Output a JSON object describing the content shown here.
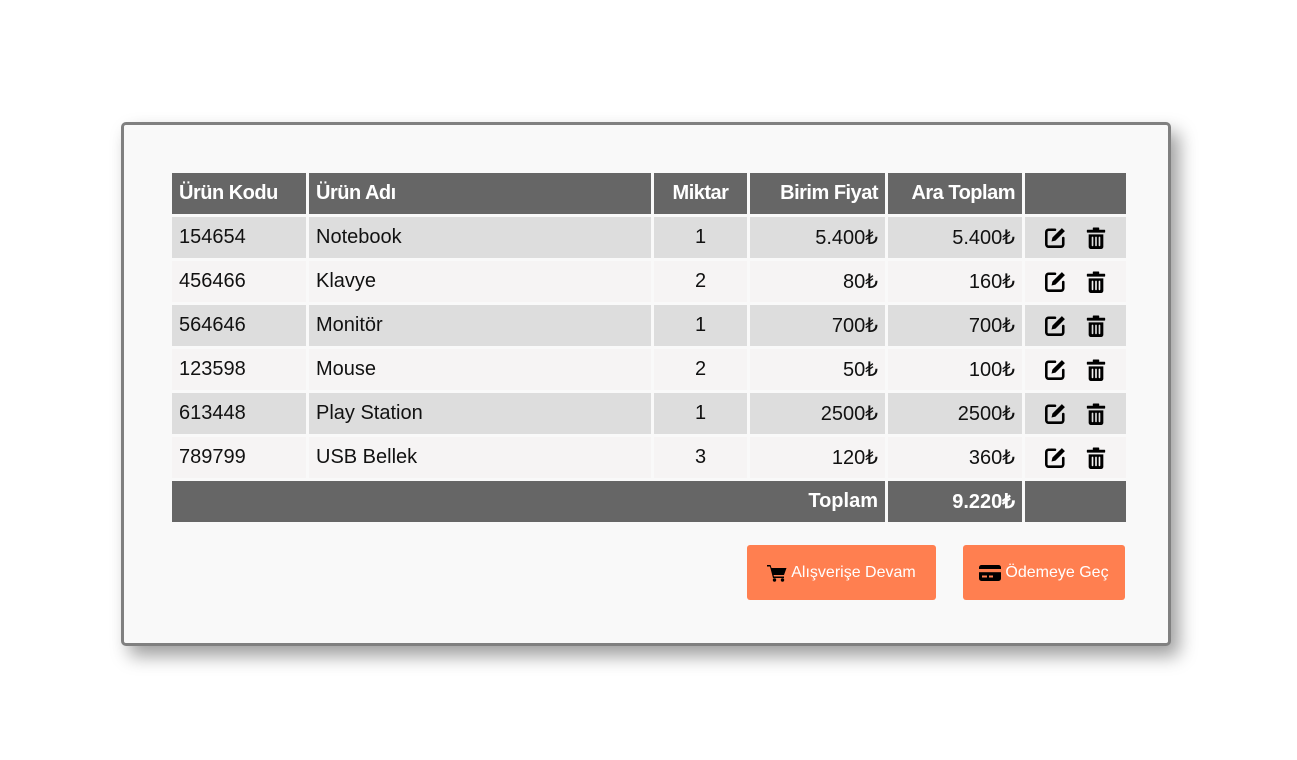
{
  "table": {
    "headers": {
      "code": "Ürün Kodu",
      "name": "Ürün Adı",
      "qty": "Miktar",
      "price": "Birim Fiyat",
      "subtotal": "Ara Toplam",
      "actions": ""
    },
    "rows": [
      {
        "code": "154654",
        "name": "Notebook",
        "qty": "1",
        "price": "5.400₺",
        "subtotal": "5.400₺"
      },
      {
        "code": "456466",
        "name": "Klavye",
        "qty": "2",
        "price": "80₺",
        "subtotal": "160₺"
      },
      {
        "code": "564646",
        "name": "Monitör",
        "qty": "1",
        "price": "700₺",
        "subtotal": "700₺"
      },
      {
        "code": "123598",
        "name": "Mouse",
        "qty": "2",
        "price": "50₺",
        "subtotal": "100₺"
      },
      {
        "code": "613448",
        "name": "Play Station",
        "qty": "1",
        "price": "2500₺",
        "subtotal": "2500₺"
      },
      {
        "code": "789799",
        "name": "USB Bellek",
        "qty": "3",
        "price": "120₺",
        "subtotal": "360₺"
      }
    ],
    "row_icons": {
      "edit": "edit-icon",
      "delete": "trash-icon"
    },
    "footer": {
      "label": "Toplam",
      "total": "9.220₺"
    }
  },
  "buttons": {
    "continue": {
      "label": "Alışverişe Devam",
      "icon": "cart-icon"
    },
    "checkout": {
      "label": "Ödemeye Geç",
      "icon": "credit-card-icon"
    }
  },
  "colors": {
    "header_bg": "#666666",
    "row_odd_bg": "#dddddd",
    "row_even_bg": "#f6f4f4",
    "button_bg": "#ff7f50",
    "card_bg": "#f9f9f9",
    "card_border": "#808080"
  }
}
